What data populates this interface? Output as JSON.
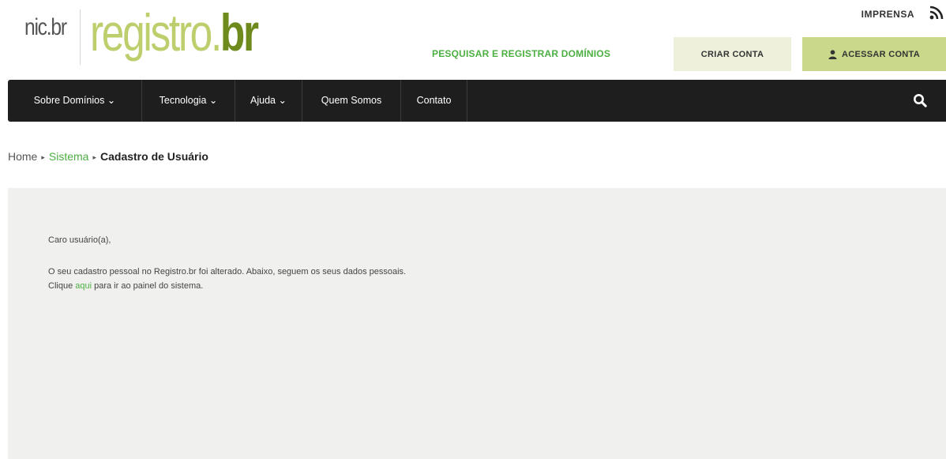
{
  "header": {
    "logo_nic": "nic.br",
    "logo_registro": "registro.",
    "logo_br": "br",
    "imprensa": "IMPRENSA",
    "search_domains": "PESQUISAR E REGISTRAR DOMÍNIOS",
    "create_account": "CRIAR CONTA",
    "login": "ACESSAR CONTA",
    "icons": {
      "rss": "rss-icon",
      "user": "user-icon",
      "search": "search-icon"
    },
    "colors": {
      "brand_light": "#bccf6c",
      "brand_dark": "#6f8a1c",
      "link_green": "#4caf42",
      "nav_bg": "#1e1e1e"
    }
  },
  "nav": {
    "items": [
      {
        "label": "Sobre Domínios ⌄"
      },
      {
        "label": "Tecnologia ⌄"
      },
      {
        "label": "Ajuda ⌄"
      },
      {
        "label": "Quem Somos"
      },
      {
        "label": "Contato"
      }
    ]
  },
  "breadcrumb": {
    "home": "Home",
    "sistema": "Sistema",
    "current": "Cadastro de Usuário"
  },
  "content": {
    "greeting": "Caro usuário(a),",
    "line1": "O seu cadastro pessoal no Registro.br foi alterado. Abaixo, seguem os seus dados pessoais.",
    "line2_prefix": "Clique ",
    "line2_link": "aqui",
    "line2_suffix": " para ir ao painel do sistema."
  }
}
